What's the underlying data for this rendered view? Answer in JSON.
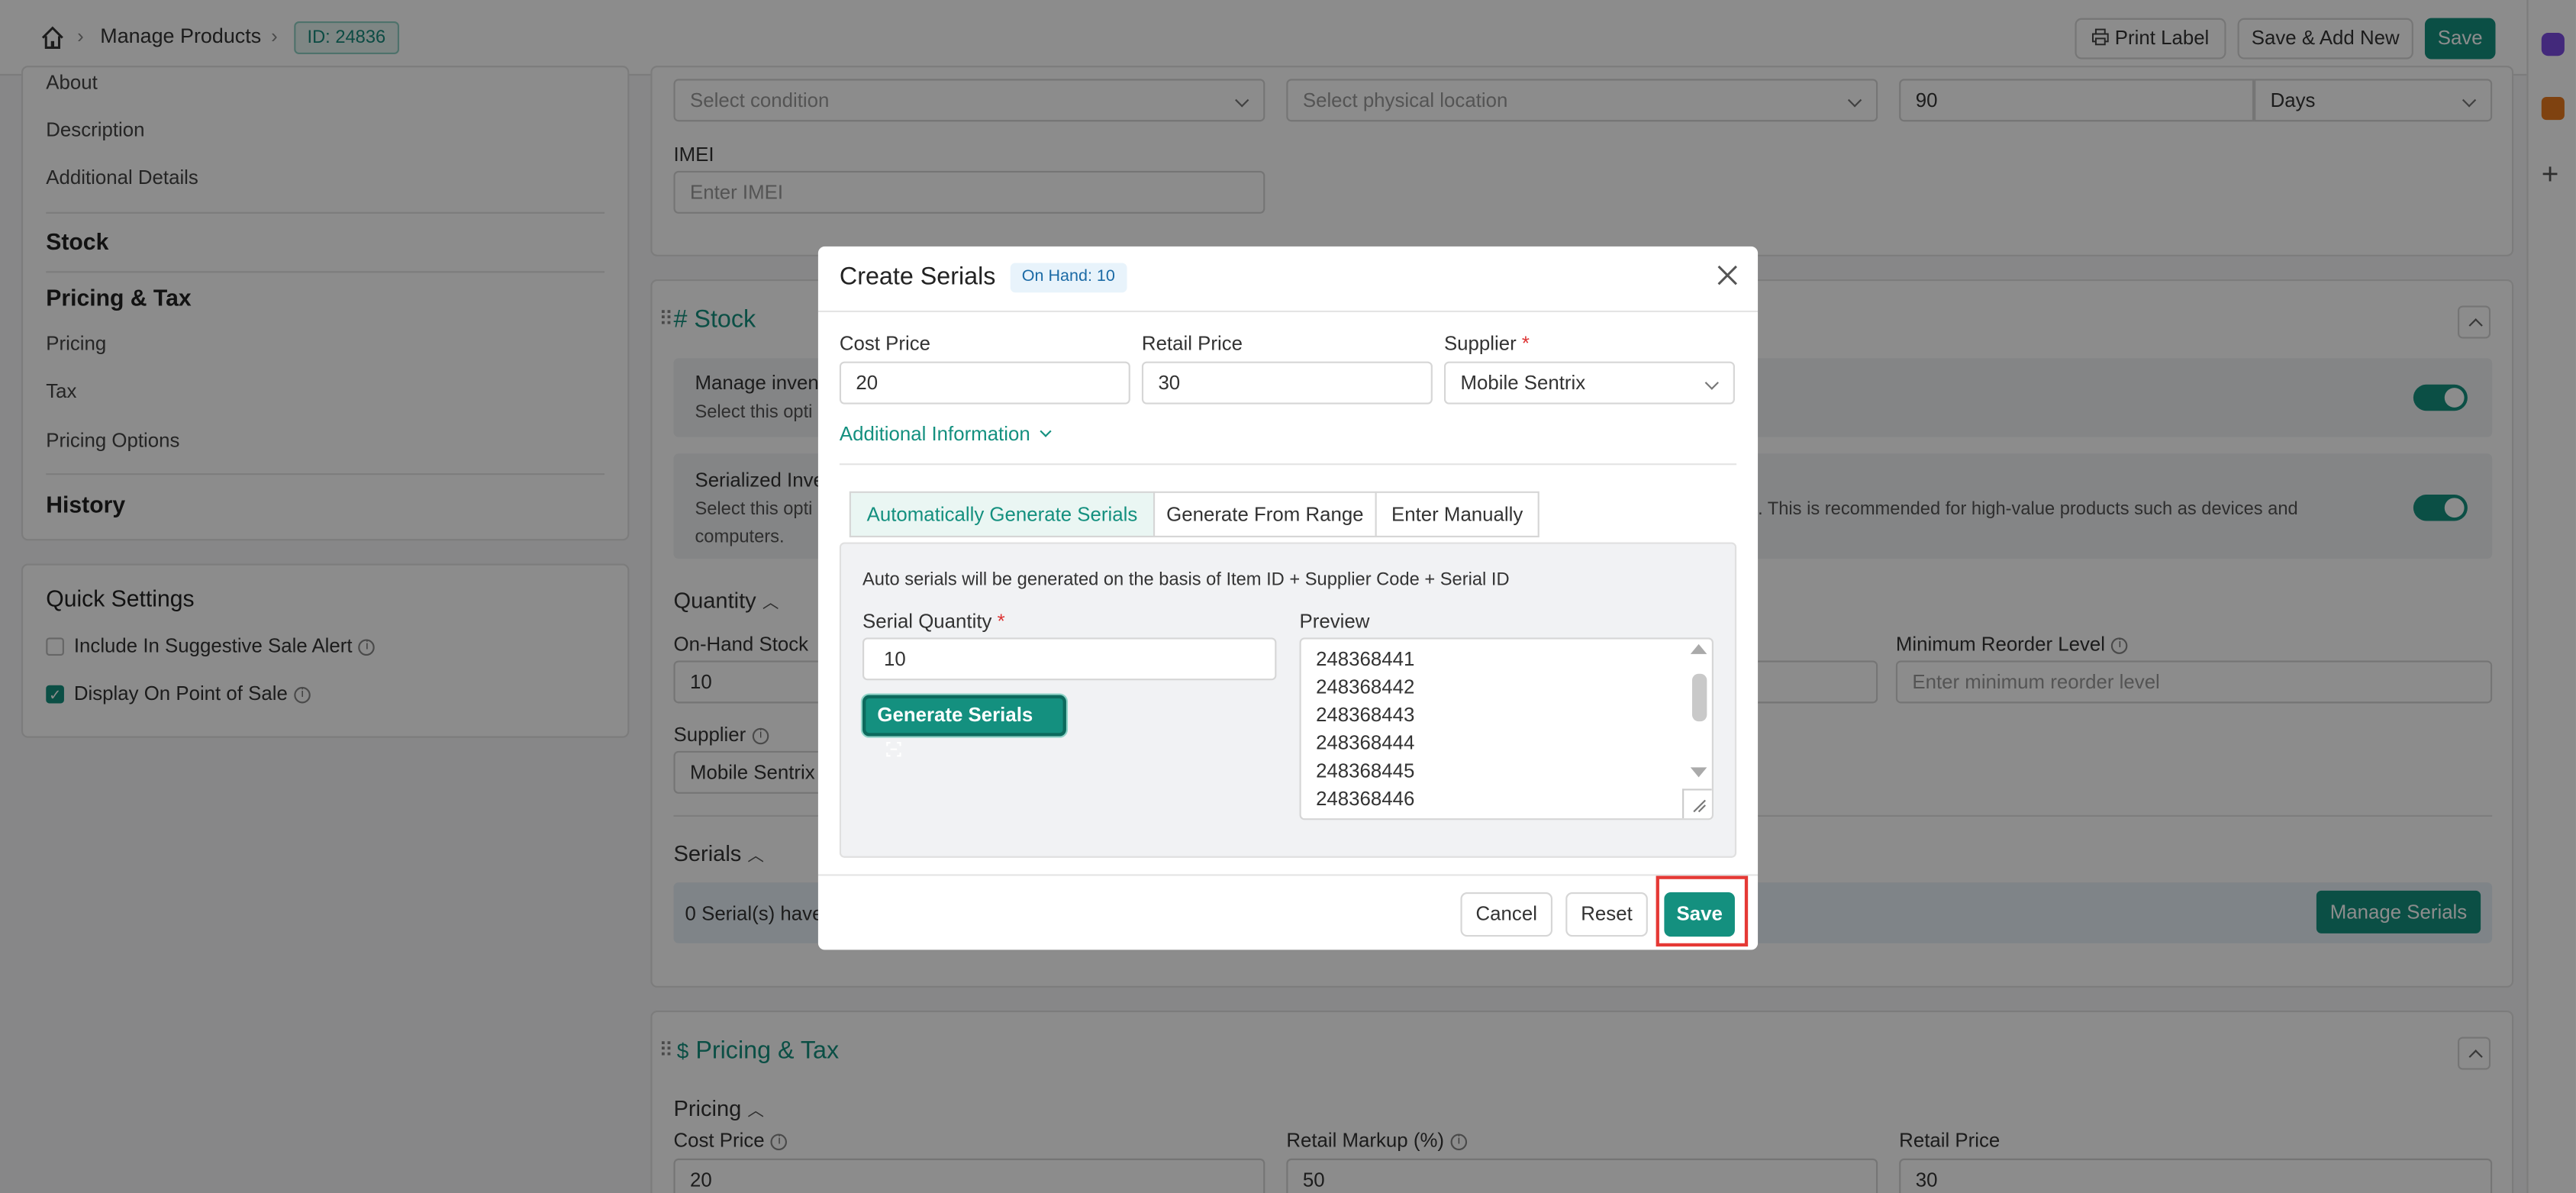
{
  "colors": {
    "accent": "#14907f",
    "highlight": "#e53935"
  },
  "topbar": {
    "home_icon": "home-icon",
    "breadcrumb_title": "Manage Products",
    "id_badge": "ID: 24836",
    "print_label": "Print Label",
    "save_add_new": "Save & Add New",
    "save": "Save"
  },
  "sidebar": {
    "links_top": [
      "About",
      "Description",
      "Additional Details"
    ],
    "stock": "Stock",
    "pricing_tax": "Pricing & Tax",
    "pricing_links": [
      "Pricing",
      "Tax",
      "Pricing Options"
    ],
    "history": "History"
  },
  "quick_settings": {
    "title": "Quick Settings",
    "items": [
      {
        "label": "Include In Suggestive Sale Alert",
        "checked": false
      },
      {
        "label": "Display On Point of Sale",
        "checked": true
      }
    ]
  },
  "top_panel": {
    "condition_placeholder": "Select condition",
    "location_placeholder": "Select physical location",
    "warranty_value": "90",
    "warranty_unit": "Days",
    "imei_label": "IMEI",
    "imei_placeholder": "Enter IMEI"
  },
  "stock_panel": {
    "title": "# Stock",
    "manage_inventory": "Manage inven",
    "manage_inventory_sub": "Select this opti",
    "serialized_title": "Serialized Inve",
    "serialized_sub_left": "Select this opti",
    "serialized_sub_right": ". This is recommended for high-value products such as devices and",
    "serialized_sub_line2": "computers.",
    "quantity_title": "Quantity",
    "on_hand_label": "On-Hand Stock",
    "on_hand_value": "10",
    "min_reorder_label": "Minimum Reorder Level",
    "min_reorder_placeholder": "Enter minimum reorder level",
    "supplier_label": "Supplier",
    "supplier_value": "Mobile Sentrix",
    "serials_title": "Serials",
    "serials_status": "0 Serial(s) have",
    "manage_serials": "Manage Serials"
  },
  "pricing_panel": {
    "title": "Pricing & Tax",
    "dollar": "$",
    "pricing_title": "Pricing",
    "cost_price_label": "Cost Price",
    "cost_price_value": "20",
    "retail_markup_label": "Retail Markup (%)",
    "retail_markup_value": "50",
    "retail_price_label": "Retail Price",
    "retail_price_value": "30"
  },
  "modal": {
    "title": "Create Serials",
    "on_hand_badge": "On Hand: 10",
    "cost_price_label": "Cost Price",
    "cost_price_value": "20",
    "retail_price_label": "Retail Price",
    "retail_price_value": "30",
    "supplier_label": "Supplier",
    "supplier_required": "*",
    "supplier_value": "Mobile Sentrix",
    "additional_info": "Additional Information",
    "tabs": [
      "Automatically Generate Serials",
      "Generate From Range",
      "Enter Manually"
    ],
    "active_tab": "Automatically Generate Serials",
    "auto_note": "Auto serials will be generated on the basis of Item ID + Supplier Code + Serial ID",
    "serial_qty_label": "Serial Quantity",
    "serial_qty_required": "*",
    "serial_qty_value": "10",
    "generate_button": "Generate Serials",
    "preview_label": "Preview",
    "preview_lines": [
      "248368441",
      "248368442",
      "248368443",
      "248368444",
      "248368445",
      "248368446"
    ],
    "cancel": "Cancel",
    "reset": "Reset",
    "save": "Save"
  }
}
